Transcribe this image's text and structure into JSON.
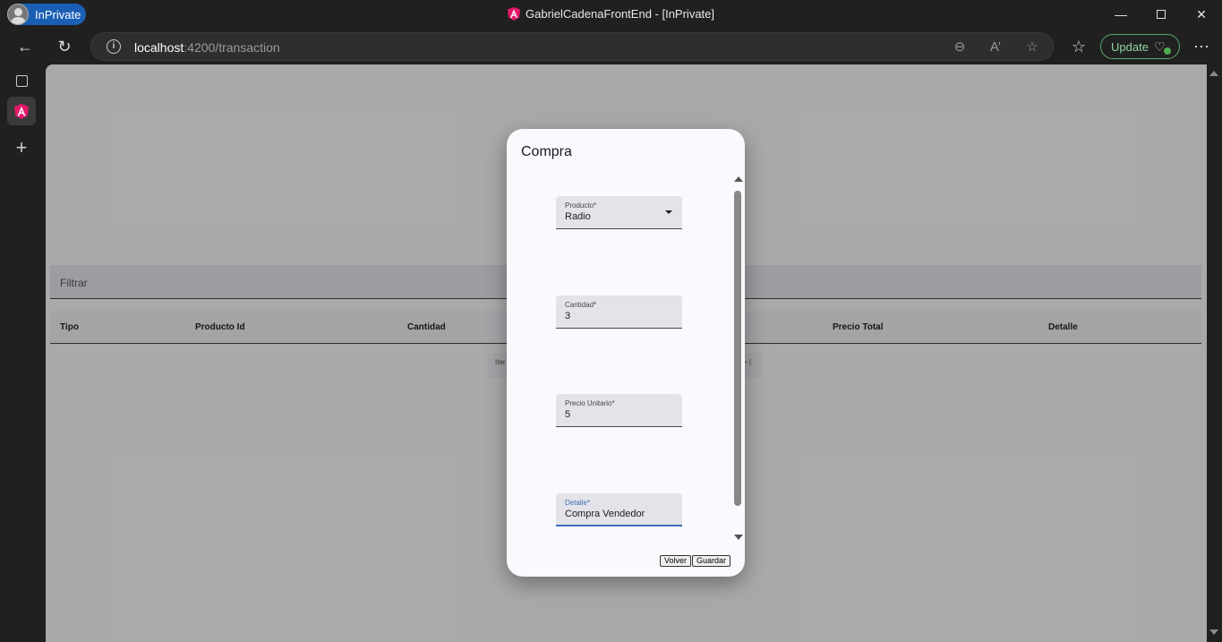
{
  "browser": {
    "inprivate_label": "InPrivate",
    "window_title": "GabrielCadenaFrontEnd - [InPrivate]",
    "url_host": "localhost",
    "url_path": ":4200/transaction",
    "update_label": "Update",
    "accent_color": "#1a5fb4"
  },
  "page": {
    "filter_label": "Filtrar",
    "columns": [
      "Tipo",
      "Producto Id",
      "Cantidad",
      "Precio Total",
      "Detalle"
    ],
    "paginator_left": "Iter",
    "paginator_right": "> |"
  },
  "dialog": {
    "title": "Compra",
    "fields": [
      {
        "label": "Producto*",
        "value": "Radio"
      },
      {
        "label": "Cantidad*",
        "value": "3"
      },
      {
        "label": "Precio Unitario*",
        "value": "5"
      },
      {
        "label": "Detalle*",
        "value": "Compra Vendedor"
      }
    ],
    "back_label": "Volver",
    "save_label": "Guardar"
  }
}
